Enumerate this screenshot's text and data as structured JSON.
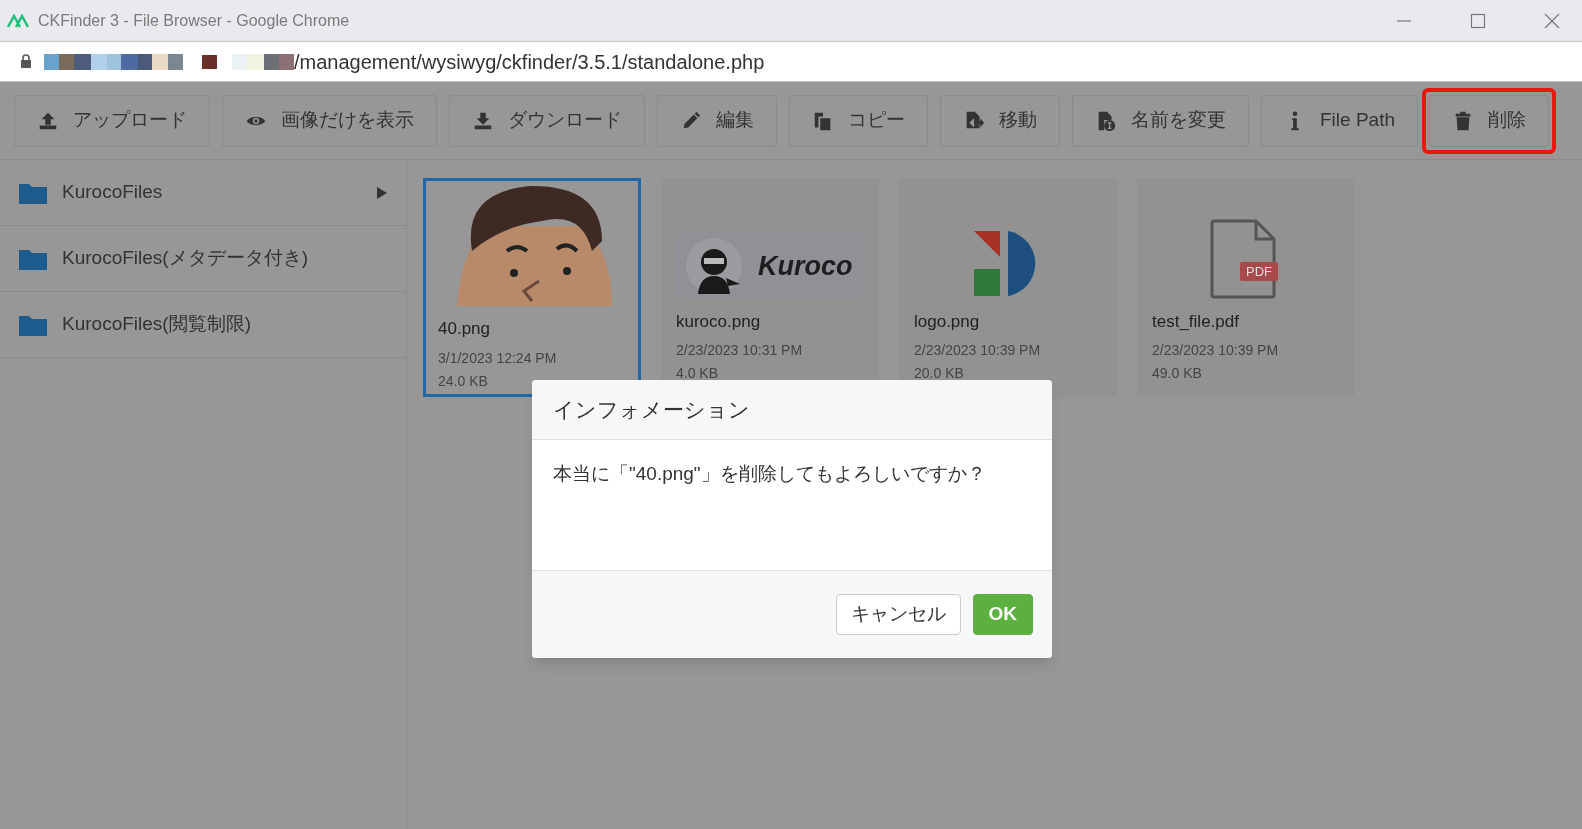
{
  "window": {
    "title": "CKFinder 3 - File Browser - Google Chrome"
  },
  "address_bar": {
    "url": "/management/wysiwyg/ckfinder/3.5.1/standalone.php"
  },
  "toolbar": [
    {
      "kind": "upload",
      "label": "アップロード",
      "highlighted": false
    },
    {
      "kind": "eye",
      "label": "画像だけを表示",
      "highlighted": false
    },
    {
      "kind": "download",
      "label": "ダウンロード",
      "highlighted": false
    },
    {
      "kind": "edit",
      "label": "編集",
      "highlighted": false
    },
    {
      "kind": "copy",
      "label": "コピー",
      "highlighted": false
    },
    {
      "kind": "move",
      "label": "移動",
      "highlighted": false
    },
    {
      "kind": "rename",
      "label": "名前を変更",
      "highlighted": false
    },
    {
      "kind": "info",
      "label": "File Path",
      "highlighted": false
    },
    {
      "kind": "delete",
      "label": "削除",
      "highlighted": true
    }
  ],
  "sidebar": {
    "items": [
      {
        "label": "KurocoFiles",
        "expandable": true
      },
      {
        "label": "KurocoFiles(メタデータ付き)",
        "expandable": false
      },
      {
        "label": "KurocoFiles(閲覧制限)",
        "expandable": false
      }
    ]
  },
  "files": [
    {
      "kind": "face",
      "name": "40.png",
      "date": "3/1/2023 12:24 PM",
      "size": "24.0 KB",
      "selected": true
    },
    {
      "kind": "kuroco",
      "name": "kuroco.png",
      "date": "2/23/2023 10:31 PM",
      "size": "4.0 KB",
      "selected": false,
      "thumbnail_text": "Kuroco"
    },
    {
      "kind": "logo",
      "name": "logo.png",
      "date": "2/23/2023 10:39 PM",
      "size": "20.0 KB",
      "selected": false
    },
    {
      "kind": "pdf",
      "name": "test_file.pdf",
      "date": "2/23/2023 10:39 PM",
      "size": "49.0 KB",
      "selected": false,
      "thumbnail_text": "PDF"
    }
  ],
  "dialog": {
    "title": "インフォメーション",
    "message": "本当に「\"40.png\"」を削除してもよろしいですか？",
    "buttons": [
      {
        "kind": "cancel",
        "label": "キャンセル"
      },
      {
        "kind": "ok",
        "label": "OK"
      }
    ]
  }
}
